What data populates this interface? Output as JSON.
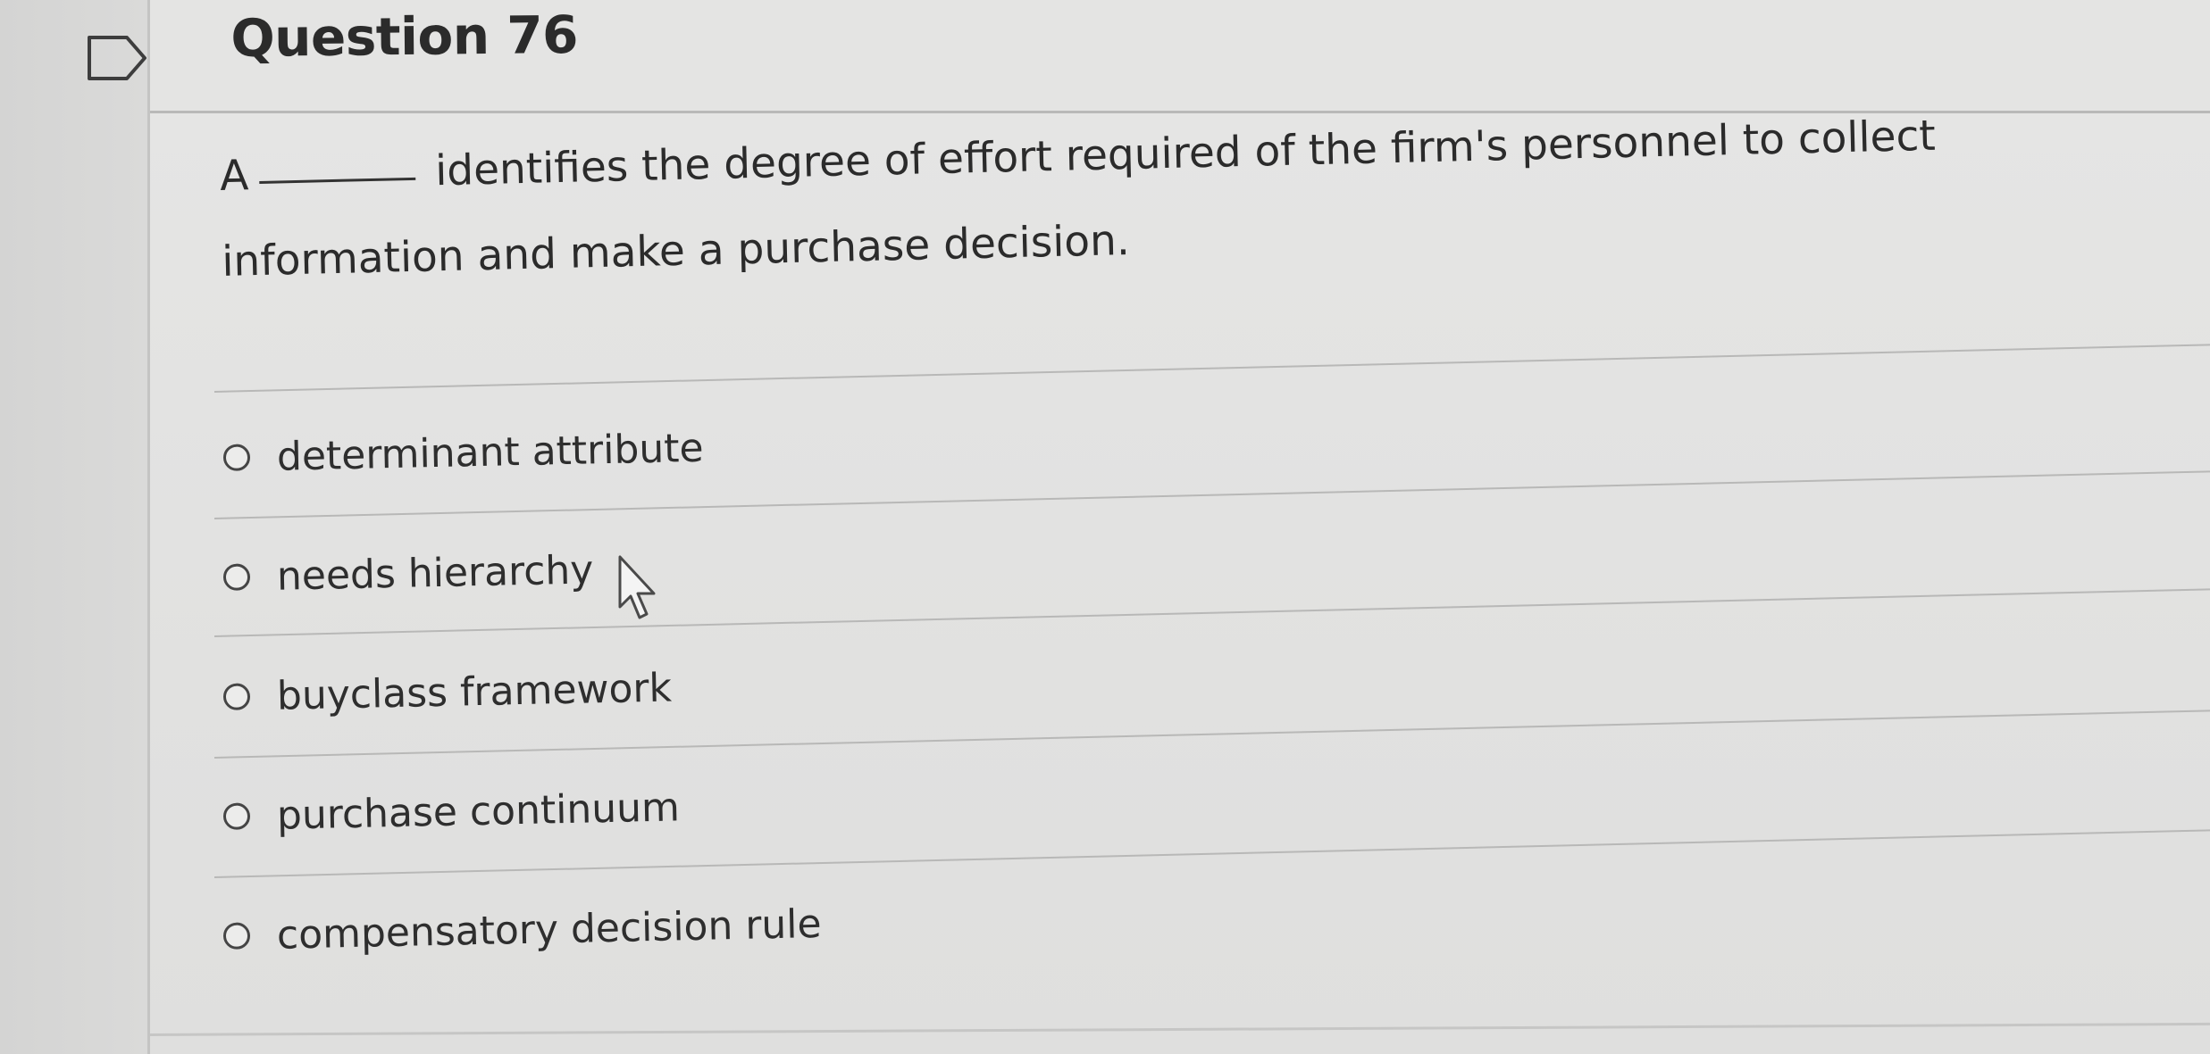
{
  "question": {
    "title": "Question 76",
    "prompt_start": "A",
    "prompt_rest": "identifies the degree of effort required of the firm's personnel to collect information and make a purchase decision."
  },
  "options": [
    {
      "label": "determinant attribute",
      "selected": false
    },
    {
      "label": "needs hierarchy",
      "selected": false
    },
    {
      "label": "buyclass framework",
      "selected": false
    },
    {
      "label": "purchase continuum",
      "selected": false
    },
    {
      "label": "compensatory decision rule",
      "selected": false
    }
  ],
  "icons": {
    "flag": "flag-icon",
    "cursor": "mouse-pointer-icon"
  },
  "colors": {
    "background": "#e3e3e2",
    "text": "#2b2b2b",
    "rule": "#b8b8b7"
  }
}
